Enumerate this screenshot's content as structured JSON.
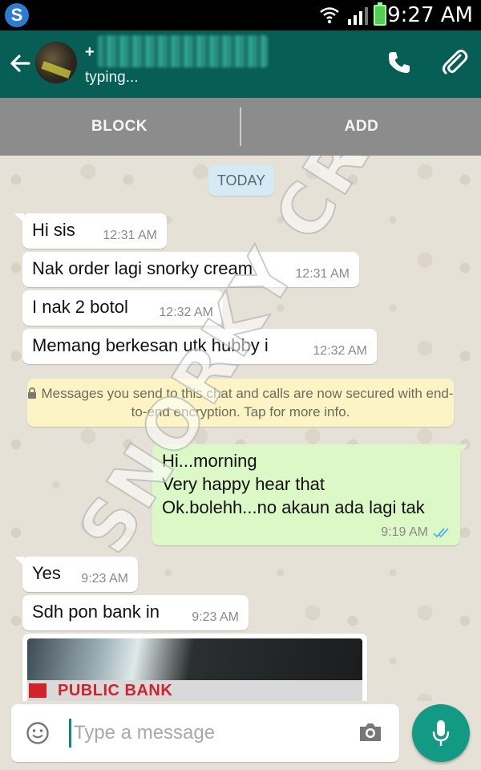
{
  "status_bar": {
    "app_icon": "S",
    "time": "9:27 AM",
    "icons": [
      "wifi-icon",
      "signal-icon",
      "battery-icon"
    ]
  },
  "header": {
    "contact_name": "+",
    "status": "typing...",
    "icons": [
      "back-arrow-icon",
      "phone-icon",
      "paperclip-icon"
    ],
    "color": "#075e54"
  },
  "actions": {
    "block_label": "BLOCK",
    "add_label": "ADD"
  },
  "chat": {
    "date_label": "TODAY",
    "incoming": [
      {
        "text": "Hi sis",
        "time": "12:31 AM"
      },
      {
        "text": "Nak order lagi snorky cream",
        "time": "12:31 AM"
      },
      {
        "text": "I nak 2 botol",
        "time": "12:32 AM"
      },
      {
        "text": "Memang berkesan utk hubby i",
        "time": "12:32 AM"
      }
    ],
    "encryption_notice": "Messages you send to this chat and calls are now secured with end-to-end encryption. Tap for more info.",
    "outgoing": {
      "lines": [
        "Hi...morning",
        "Very happy hear that",
        "Ok.bolehh...no akaun ada lagi tak"
      ],
      "time": "9:19 AM",
      "status_icon": "double-check-icon",
      "bubble_color": "#dcf8c6"
    },
    "incoming_after": [
      {
        "text": "Yes",
        "time": "9:23 AM"
      },
      {
        "text": "Sdh pon bank in",
        "time": "9:23 AM"
      }
    ],
    "image_message": {
      "visible_text": "PUBLIC BANK"
    },
    "watermark": "SNORKY CREAM"
  },
  "input_bar": {
    "placeholder": "Type a message",
    "icons": [
      "emoji-icon",
      "camera-icon",
      "microphone-icon"
    ],
    "accent": "#129a85"
  }
}
